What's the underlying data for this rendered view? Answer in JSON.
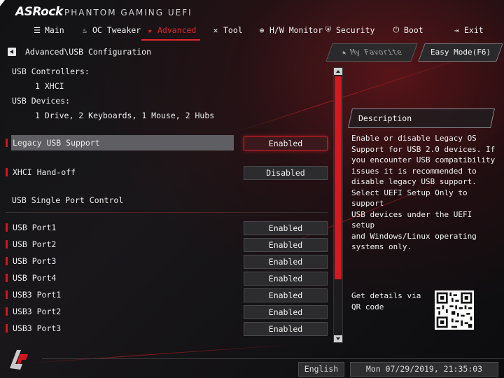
{
  "header": {
    "logo": "ASRock",
    "product": "PHANTOM GAMING UEFI"
  },
  "menu": [
    {
      "label": "Main",
      "icon": "list-icon"
    },
    {
      "label": "OC Tweaker",
      "icon": "flame-icon"
    },
    {
      "label": "Advanced",
      "icon": "star-icon",
      "active": true
    },
    {
      "label": "Tool",
      "icon": "tools-icon"
    },
    {
      "label": "H/W Monitor",
      "icon": "monitor-icon"
    },
    {
      "label": "Security",
      "icon": "shield-icon"
    },
    {
      "label": "Boot",
      "icon": "power-icon"
    },
    {
      "label": "Exit",
      "icon": "exit-icon"
    }
  ],
  "breadcrumb": "Advanced\\USB Configuration",
  "info": {
    "controllers_label": "USB Controllers:",
    "controllers_value": "1 XHCI",
    "devices_label": "USB Devices:",
    "devices_value": "1 Drive, 2 Keyboards, 1 Mouse, 2 Hubs"
  },
  "settings": {
    "legacy": {
      "label": "Legacy USB Support",
      "value": "Enabled"
    },
    "xhci": {
      "label": "XHCI Hand-off",
      "value": "Disabled"
    }
  },
  "single_port_title": "USB Single Port Control",
  "ports": [
    {
      "label": "USB Port1",
      "value": "Enabled"
    },
    {
      "label": "USB Port2",
      "value": "Enabled"
    },
    {
      "label": "USB Port3",
      "value": "Enabled"
    },
    {
      "label": "USB Port4",
      "value": "Enabled"
    },
    {
      "label": "USB3 Port1",
      "value": "Enabled"
    },
    {
      "label": "USB3 Port2",
      "value": "Enabled"
    },
    {
      "label": "USB3 Port3",
      "value": "Enabled"
    }
  ],
  "right": {
    "favorite_label": "My Favorite",
    "easy_mode_label": "Easy Mode(F6)",
    "description_title": "Description",
    "description_text": "Enable or disable Legacy OS\nSupport for USB 2.0 devices. If\nyou encounter USB compatibility\nissues it is recommended to\ndisable legacy USB support.\nSelect UEFI Setup Only to support\nUSB devices under the UEFI setup\nand Windows/Linux operating\nsystems only.",
    "qr_label": "Get details via QR code"
  },
  "footer": {
    "language": "English",
    "datetime": "Mon 07/29/2019, 21:35:03"
  },
  "colors": {
    "accent": "#d3151c",
    "background": "#0d0d0f"
  }
}
